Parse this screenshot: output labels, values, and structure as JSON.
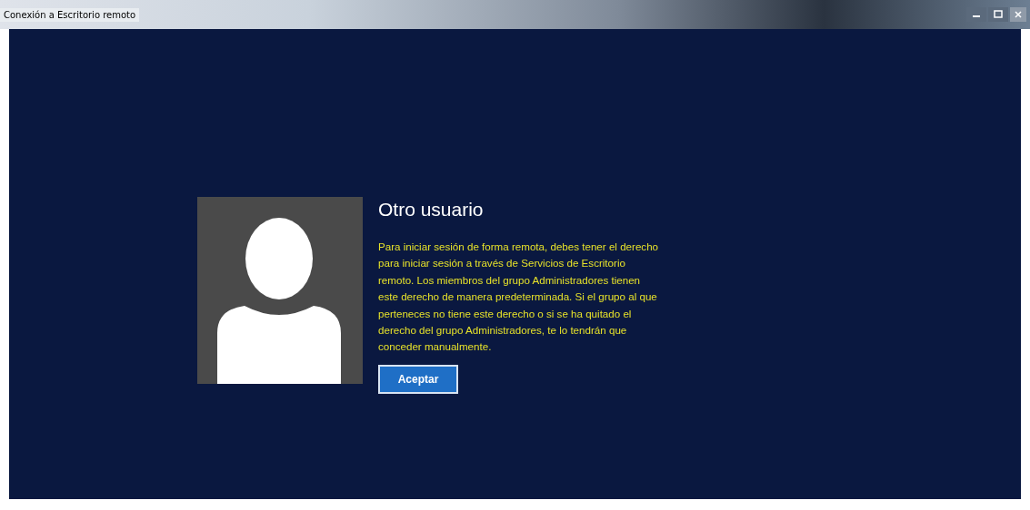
{
  "window": {
    "title": "Conexión a Escritorio remoto"
  },
  "dialog": {
    "user_name": "Otro usuario",
    "message": "Para iniciar sesión de forma remota, debes tener el derecho para iniciar sesión a través de Servicios de Escritorio remoto. Los miembros del grupo Administradores tienen este derecho de manera predeterminada. Si el grupo al que perteneces no tiene este derecho o si se ha quitado el derecho del grupo Administradores, te lo tendrán que conceder manualmente.",
    "button": "Aceptar"
  }
}
